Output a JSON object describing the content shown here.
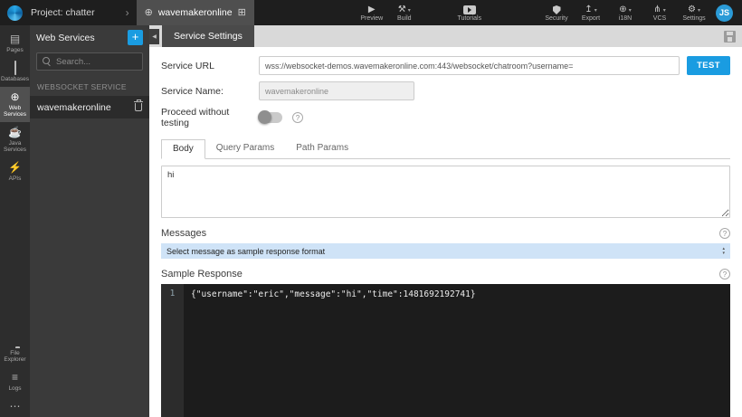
{
  "icons": {
    "play": "▶",
    "build": "⚒",
    "caret": "▾",
    "chevron_right": "›",
    "globe": "⊕",
    "grid": "⊞",
    "export": "↥",
    "vcs": "⋔",
    "settings": "⚙",
    "pages": "▤",
    "java": "☕",
    "apis": "⚡",
    "logs": "≡",
    "more": "⋯",
    "collapse": "◀",
    "scroll_up": "▴",
    "scroll_down": "▾",
    "help": "?",
    "plus": "+"
  },
  "colors": {
    "accent_blue": "#1a9ce1",
    "messages_bar_bg": "#cfe3f7",
    "editor_bg": "#1c1c1c",
    "topbar_bg": "#1e1e1e"
  },
  "topbar": {
    "project": "Project: chatter",
    "service_tab": "wavemakeronline",
    "preview": "Preview",
    "build": "Build",
    "tutorials": "Tutorials",
    "security": "Security",
    "export": "Export",
    "i18n": "i18N",
    "vcs": "VCS",
    "settings": "Settings",
    "avatar": "JS"
  },
  "sidebar": {
    "items": [
      "Pages",
      "Databases",
      "Web Services",
      "Java Services",
      "APIs"
    ],
    "bottom_items": [
      "File Explorer",
      "Logs"
    ]
  },
  "panel": {
    "title": "Web Services",
    "search_placeholder": "Search...",
    "section": "WEBSOCKET SERVICE",
    "service": "wavemakeronline"
  },
  "main": {
    "tab": "Service Settings",
    "service_url_label": "Service URL",
    "service_url": "wss://websocket-demos.wavemakeronline.com:443/websocket/chatroom?username=",
    "test": "TEST",
    "service_name_label": "Service Name:",
    "service_name": "wavemakeronline",
    "proceed_label": "Proceed without testing",
    "tabs": [
      "Body",
      "Query Params",
      "Path Params"
    ],
    "body_text": "hi",
    "messages_title": "Messages",
    "messages_bar": "Select message as sample response format",
    "sample_title": "Sample Response",
    "code_line_no": "1",
    "code": "{\"username\":\"eric\",\"message\":\"hi\",\"time\":1481692192741}"
  }
}
